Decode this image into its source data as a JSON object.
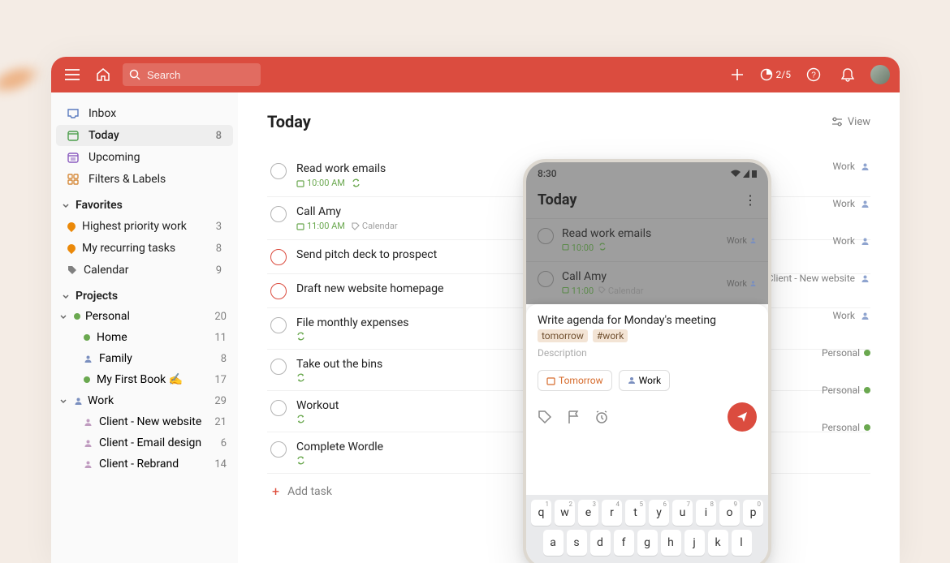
{
  "topbar": {
    "search_placeholder": "Search",
    "productivity": "2/5"
  },
  "sidebar": {
    "nav": [
      {
        "id": "inbox",
        "label": "Inbox",
        "count": ""
      },
      {
        "id": "today",
        "label": "Today",
        "count": "8"
      },
      {
        "id": "upcoming",
        "label": "Upcoming",
        "count": ""
      },
      {
        "id": "filters",
        "label": "Filters & Labels",
        "count": ""
      }
    ],
    "favorites_header": "Favorites",
    "favorites": [
      {
        "label": "Highest priority work",
        "count": "3",
        "color": "#eb8909"
      },
      {
        "label": "My recurring tasks",
        "count": "8",
        "color": "#eb8909"
      },
      {
        "label": "Calendar",
        "count": "9",
        "color": "#808080"
      }
    ],
    "projects_header": "Projects",
    "projects": [
      {
        "label": "Personal",
        "count": "20",
        "color": "#6aa84f",
        "children": [
          {
            "label": "Home",
            "count": "11",
            "icon": "dot",
            "color": "#6aa84f"
          },
          {
            "label": "Family",
            "count": "8",
            "icon": "person",
            "color": "#7a8fbf"
          },
          {
            "label": "My First Book ✍️",
            "count": "17",
            "icon": "dot",
            "color": "#6aa84f"
          }
        ]
      },
      {
        "label": "Work",
        "count": "29",
        "color": "#7a8fbf",
        "icon": "person",
        "children": [
          {
            "label": "Client - New website",
            "count": "21",
            "icon": "person",
            "color": "#c09cc0"
          },
          {
            "label": "Client - Email design",
            "count": "6",
            "icon": "person",
            "color": "#c09cc0"
          },
          {
            "label": "Client - Rebrand",
            "count": "14",
            "icon": "person",
            "color": "#c09cc0"
          }
        ]
      }
    ]
  },
  "main": {
    "title": "Today",
    "view_label": "View",
    "add_task_label": "Add task",
    "tasks": [
      {
        "title": "Read work emails",
        "time": "10:00 AM",
        "recur": true,
        "project": "Work",
        "proj_icon": "person",
        "priority": false
      },
      {
        "title": "Call Amy",
        "time": "11:00 AM",
        "recur": false,
        "calendar": "Calendar",
        "project": "Work",
        "proj_icon": "person",
        "priority": false
      },
      {
        "title": "Send pitch deck to prospect",
        "project": "Work",
        "proj_icon": "person",
        "priority": true
      },
      {
        "title": "Draft new website homepage",
        "project": "Client - New website",
        "proj_icon": "person",
        "priority": true
      },
      {
        "title": "File monthly expenses",
        "recur": true,
        "project": "Work",
        "proj_icon": "person",
        "priority": false
      },
      {
        "title": "Take out the bins",
        "recur": true,
        "project": "Personal",
        "proj_icon": "dot",
        "priority": false
      },
      {
        "title": "Workout",
        "recur": true,
        "project": "Personal",
        "proj_icon": "dot",
        "priority": false
      },
      {
        "title": "Complete Wordle",
        "recur": true,
        "project": "Personal",
        "proj_icon": "dot",
        "priority": false
      }
    ]
  },
  "phone": {
    "status_time": "8:30",
    "header_title": "Today",
    "tasks": [
      {
        "title": "Read work emails",
        "time": "10:00",
        "recur": true,
        "project": "Work"
      },
      {
        "title": "Call Amy",
        "time": "11:00",
        "calendar": "Calendar",
        "project": "Work"
      }
    ],
    "compose": {
      "text": "Write agenda for Monday's meeting",
      "tags": [
        "tomorrow",
        "#work"
      ],
      "description_placeholder": "Description",
      "chip_date": "Tomorrow",
      "chip_project": "Work"
    },
    "keyboard_row1": [
      "q",
      "w",
      "e",
      "r",
      "t",
      "y",
      "u",
      "i",
      "o",
      "p"
    ],
    "keyboard_row1_nums": [
      "1",
      "2",
      "3",
      "4",
      "5",
      "6",
      "7",
      "8",
      "9",
      "0"
    ],
    "keyboard_row2": [
      "a",
      "s",
      "d",
      "f",
      "g",
      "h",
      "j",
      "k",
      "l"
    ]
  }
}
